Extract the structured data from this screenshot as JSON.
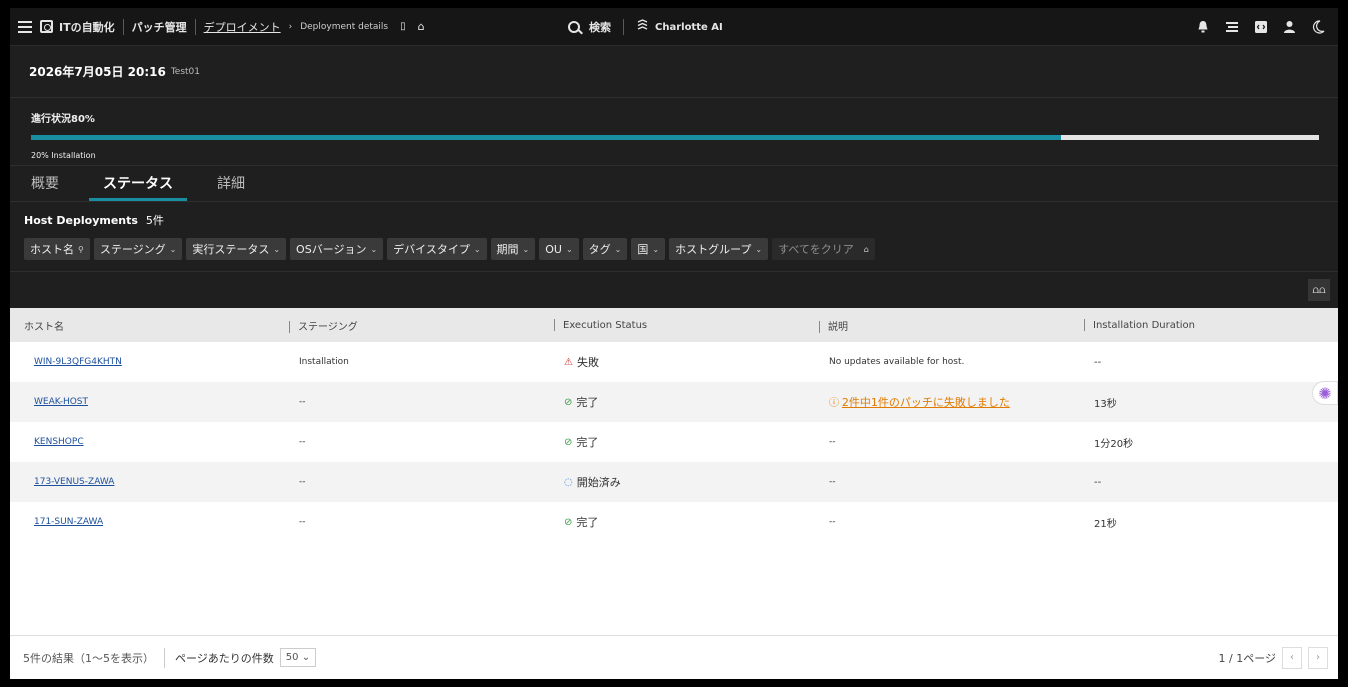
{
  "topbar": {
    "app_name": "ITの自動化",
    "section": "パッチ管理",
    "page": "デプロイメント",
    "sub_page": "Deployment details",
    "search_label": "検索",
    "assistant_label": "Charlotte AI"
  },
  "deployment": {
    "date": "2026年7月05日 20:16",
    "name": "Test01"
  },
  "progress": {
    "label": "進行状況80%",
    "value": 0.8,
    "sub_label": "20% Installation"
  },
  "tabs": [
    "概要",
    "ステータス",
    "詳細"
  ],
  "host_deployments": {
    "title": "Host Deployments",
    "count": "5件"
  },
  "filters": [
    "ホスト名",
    "ステージング",
    "実行ステータス",
    "OSバージョン",
    "デバイスタイプ",
    "期間",
    "OU",
    "タグ",
    "国",
    "ホストグループ"
  ],
  "clear_all": "すべてをクリア",
  "columns_button": "⩍⩍",
  "table": {
    "headers": [
      "ホスト名",
      "ステージング",
      "Execution Status",
      "説明",
      "Installation Duration"
    ],
    "rows": [
      {
        "host": "WIN-9L3QFG4KHTN",
        "staging": "Installation",
        "status": "失敗",
        "status_type": "fail",
        "desc": "No updates available for host.",
        "desc_type": "text",
        "duration": "--"
      },
      {
        "host": "WEAK-HOST",
        "staging": "--",
        "status": "完了",
        "status_type": "ok",
        "desc": "2件中1件のパッチに失敗しました",
        "desc_type": "warn",
        "duration": "13秒"
      },
      {
        "host": "KENSHOPC",
        "staging": "--",
        "status": "完了",
        "status_type": "ok",
        "desc": "--",
        "desc_type": "text",
        "duration": "1分20秒"
      },
      {
        "host": "173-VENUS-ZAWA",
        "staging": "--",
        "status": "開始済み",
        "status_type": "run",
        "desc": "--",
        "desc_type": "text",
        "duration": "--"
      },
      {
        "host": "171-SUN-ZAWA",
        "staging": "--",
        "status": "完了",
        "status_type": "ok",
        "desc": "--",
        "desc_type": "text",
        "duration": "21秒"
      }
    ]
  },
  "footer": {
    "results": "5件の結果（1〜5を表示）",
    "per_page_label": "ページあたりの件数",
    "per_page_value": "50",
    "page_info": "1 / 1ページ"
  },
  "colors": {
    "accent": "#1a8ea1",
    "fail": "#d12d2d",
    "ok": "#3a9a4d",
    "warn": "#e07b00",
    "link": "#1b4f9c"
  }
}
